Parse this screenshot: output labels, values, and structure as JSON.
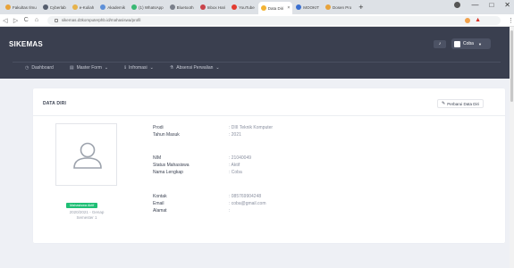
{
  "browser": {
    "tabs": [
      {
        "label": "Fakultas Ilmu",
        "color": "#e8a33b"
      },
      {
        "label": "Cyberlab",
        "color": "#555e6e"
      },
      {
        "label": "e-Kuliah",
        "color": "#e6b24a"
      },
      {
        "label": "Akademik",
        "color": "#5d8fd8"
      },
      {
        "label": "(1) WhatsApp",
        "color": "#39b873"
      },
      {
        "label": "Bluetooth",
        "color": "#7a7f8a"
      },
      {
        "label": "Inbox Hari",
        "color": "#c9434a"
      },
      {
        "label": "YouTube",
        "color": "#e33b2f"
      },
      {
        "label": "Data Diri",
        "color": "#f2b233",
        "active": true
      },
      {
        "label": "MOOKIT",
        "color": "#3a6fd0"
      },
      {
        "label": "Dosen Pro",
        "color": "#e8a33b"
      }
    ],
    "new_tab": "+",
    "url": "sikemas.d3komputerphb.id/mahasiswa/profil",
    "nav": {
      "back": "◁",
      "forward": "▷",
      "reload": "C",
      "home": "⌂"
    },
    "window": {
      "minimize": "—",
      "maximize": "□",
      "close": "✕"
    },
    "menu": "⋮"
  },
  "app": {
    "brand": "SIKEMAS",
    "user_name": "Coba",
    "notif_icon": "bell-icon",
    "menu": [
      {
        "label": "Dashboard",
        "icon": "◷"
      },
      {
        "label": "Master Form",
        "icon": "▤",
        "caret": "⌄"
      },
      {
        "label": "Infromasi",
        "icon": "ℹ",
        "caret": "⌄"
      },
      {
        "label": "Absensi Perwalian",
        "icon": "⚗",
        "caret": "⌄"
      }
    ]
  },
  "card": {
    "title": "DATA DIRI",
    "update_button": "Perbarui Data Diri",
    "status_badge": "Mahasiswa Aktif",
    "semester_line1": "2020/2021 - Genap",
    "semester_line2": "Semester 1",
    "groups": [
      [
        {
          "label": "Prodi",
          "value": ": DIII Teknik Komputer"
        },
        {
          "label": "Tahun Masuk",
          "value": ": 2021"
        }
      ],
      [
        {
          "label": "NIM",
          "value": ": 21040049"
        },
        {
          "label": "Status Mahasiswa",
          "value": ": Aktif"
        },
        {
          "label": "Nama Lengkap",
          "value": ": Coba"
        }
      ],
      [
        {
          "label": "Kontak",
          "value": ": 085769904248"
        },
        {
          "label": "Email",
          "value": ": coba@gmail.com"
        },
        {
          "label": "Alamat",
          "value": ":"
        }
      ]
    ]
  }
}
